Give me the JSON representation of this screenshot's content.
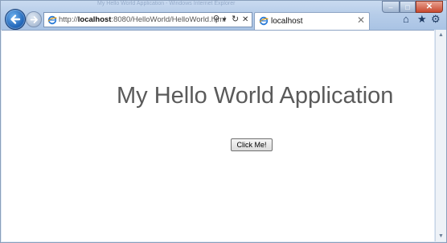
{
  "window": {
    "faded_title": "My Hello World Application - Windows Internet Explorer",
    "minimize_label": "–",
    "maximize_label": "□",
    "close_label": "✕"
  },
  "toolbar": {
    "address_prefix": "http://",
    "address_host": "localhost",
    "address_rest": ":8080/HelloWorld/HelloWorld.html",
    "search_glyph": "⚲",
    "dropdown_glyph": "▾",
    "refresh_glyph": "↻",
    "stop_glyph": "✕",
    "home_glyph": "⌂",
    "favorites_glyph": "★",
    "tools_glyph": "⚙",
    "back_glyph": "←",
    "forward_glyph": "→"
  },
  "tab": {
    "label": "localhost",
    "close_glyph": "✕"
  },
  "page": {
    "heading": "My Hello World Application",
    "button_label": "Click Me!"
  },
  "colors": {
    "chrome": "#b7cde9",
    "heading_text": "#5a5a5a",
    "back_button": "#1f64b7"
  }
}
